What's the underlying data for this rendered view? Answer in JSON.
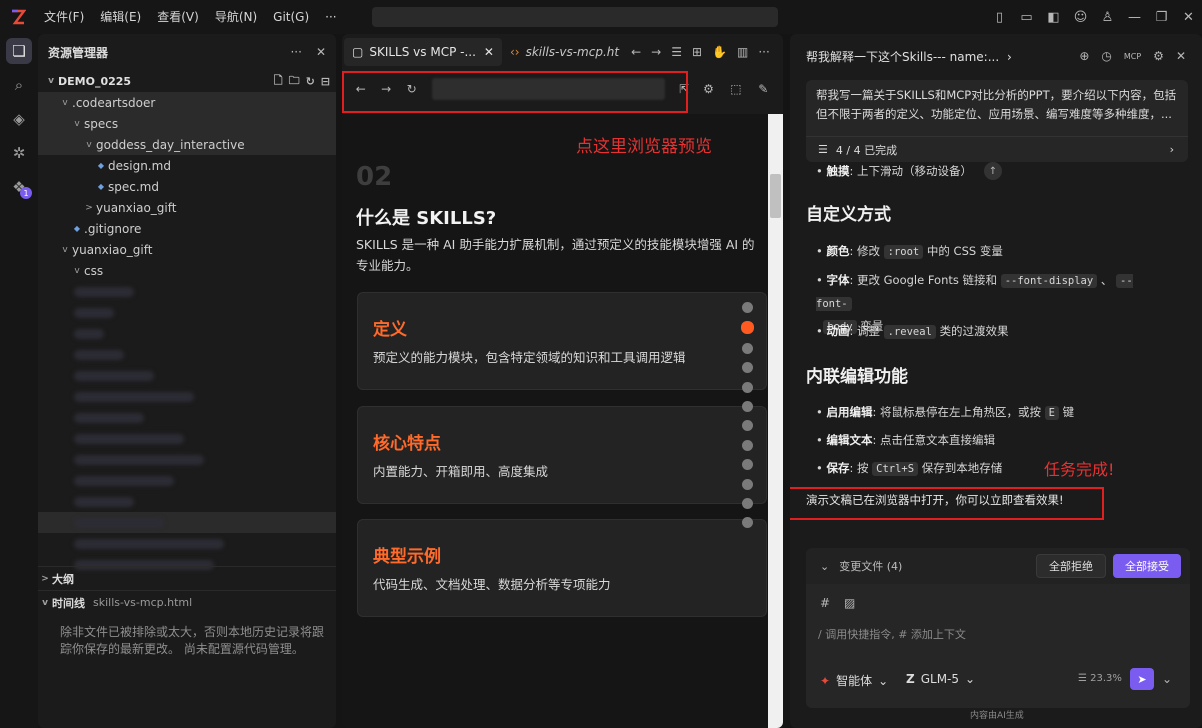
{
  "menu": [
    "文件(F)",
    "编辑(E)",
    "查看(V)",
    "导航(N)",
    "Git(G)",
    "···"
  ],
  "activity_badge": "1",
  "explorer": {
    "title": "资源管理器",
    "root": "DEMO_0225",
    "tree": [
      {
        "label": ".codeartsdoer",
        "indent": 1,
        "chev": "v"
      },
      {
        "label": "specs",
        "indent": 2,
        "chev": "v"
      },
      {
        "label": "goddess_day_interactive",
        "indent": 3,
        "chev": "v"
      },
      {
        "label": "design.md",
        "indent": 4,
        "chev": ""
      },
      {
        "label": "spec.md",
        "indent": 4,
        "chev": ""
      },
      {
        "label": "yuanxiao_gift",
        "indent": 3,
        "chev": ">"
      },
      {
        "label": ".gitignore",
        "indent": 2,
        "chev": ""
      },
      {
        "label": "yuanxiao_gift",
        "indent": 1,
        "chev": "v"
      },
      {
        "label": "css",
        "indent": 2,
        "chev": "v"
      }
    ],
    "outline": "大纲",
    "timeline": "时间线",
    "timeline_file": "skills-vs-mcp.html",
    "timeline_desc": "除非文件已被排除或太大，否则本地历史记录将跟踪你保存的最新更改。 尚未配置源代码管理。"
  },
  "editor": {
    "tab_active": "SKILLS vs MCP -...",
    "tab_other": "skills-vs-mcp.ht",
    "annotation": "点这里浏览器预览"
  },
  "slide": {
    "number": "02",
    "title": "什么是 SKILLS?",
    "desc": "SKILLS 是一种 AI 助手能力扩展机制，通过预定义的技能模块增强 AI 的专业能力。",
    "cards": [
      {
        "title": "定义",
        "text": "预定义的能力模块，包含特定领域的知识和工具调用逻辑"
      },
      {
        "title": "核心特点",
        "text": "内置能力、开箱即用、高度集成"
      },
      {
        "title": "典型示例",
        "text": "代码生成、文档处理、数据分析等专项能力"
      }
    ],
    "dots_total": 12,
    "dots_active_index": 1
  },
  "chat": {
    "title": "帮我解释一下这个Skills--- name:...",
    "prompt": "帮我写一篇关于SKILLS和MCP对比分析的PPT，要介绍以下内容，包括但不限于两者的定义、功能定位、应用场景、编写难度等多种维度，...",
    "progress": "4 / 4 已完成",
    "touch_label": "触摸",
    "touch_text": ": 上下滑动（移动设备）",
    "section1": "自定义方式",
    "s1_colors_label": "颜色",
    "s1_colors_text": ": 修改",
    "s1_colors_code": ":root",
    "s1_colors_tail": "中的 CSS 变量",
    "s1_font_label": "字体",
    "s1_font_text": ": 更改 Google Fonts 链接和",
    "s1_font_code1": "--font-display",
    "s1_font_sep": "、",
    "s1_font_code2a": "--font-",
    "s1_font_code2b": "body",
    "s1_font_tail": "变量",
    "s1_anim_label": "动画",
    "s1_anim_text": ": 调整",
    "s1_anim_code": ".reveal",
    "s1_anim_tail": "类的过渡效果",
    "section2": "内联编辑功能",
    "s2_enable_label": "启用编辑",
    "s2_enable_text": ": 将鼠标悬停在左上角热区，或按",
    "s2_enable_code": "E",
    "s2_enable_tail": "键",
    "s2_edit_label": "编辑文本",
    "s2_edit_text": ": 点击任意文本直接编辑",
    "s2_save_label": "保存",
    "s2_save_text": ": 按",
    "s2_save_code": "Ctrl+S",
    "s2_save_tail": "保存到本地存储",
    "done_annotation": "任务完成!",
    "final": "演示文稿已在浏览器中打开，你可以立即查看效果!",
    "changes": "变更文件 (4)",
    "reject_all": "全部拒绝",
    "accept_all": "全部接受",
    "input_placeholder": "/ 调用快捷指令, # 添加上下文",
    "agent": "智能体",
    "model": "GLM-5",
    "context_pct": "23.3%",
    "footer": "内容由AI生成"
  },
  "colors": {
    "accent_orange": "#ff6a2a",
    "accent_purple": "#7b5cf0",
    "annotation_red": "#e02020"
  }
}
